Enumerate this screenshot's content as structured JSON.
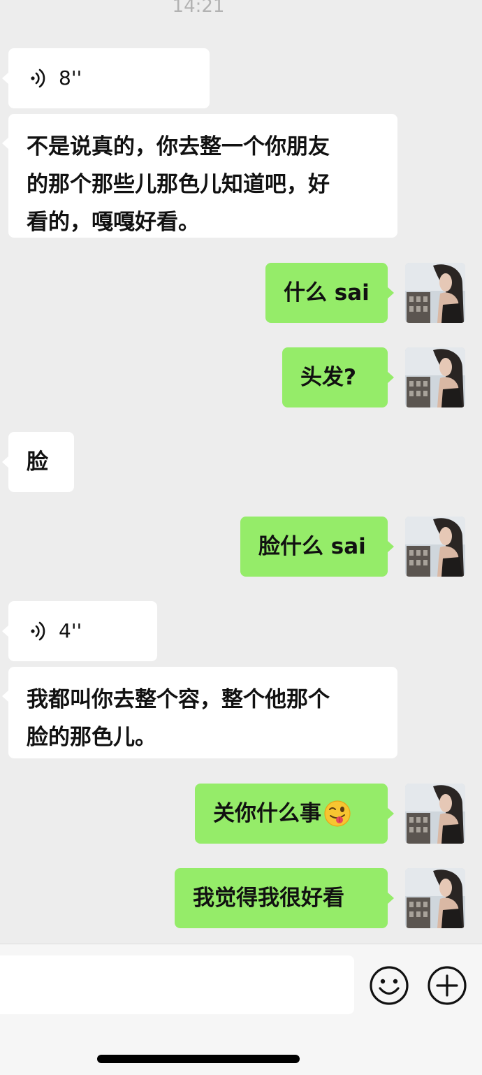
{
  "status": {
    "time": "14:21"
  },
  "messages": [
    {
      "kind": "voice",
      "side": "in",
      "duration": "8''",
      "icon": "voice-wave-icon"
    },
    {
      "kind": "text",
      "side": "in",
      "lines": [
        "不是说真的，你去整一个你朋友",
        "的那个那些儿那色儿知道吧，好",
        "看的，嘎嘎好看。"
      ]
    },
    {
      "kind": "text",
      "side": "out",
      "text": "什么 sai"
    },
    {
      "kind": "text",
      "side": "out",
      "text": "头发?"
    },
    {
      "kind": "text",
      "side": "in",
      "text": "脸"
    },
    {
      "kind": "text",
      "side": "out",
      "text": "脸什么 sai"
    },
    {
      "kind": "voice",
      "side": "in",
      "duration": "4''",
      "icon": "voice-wave-icon"
    },
    {
      "kind": "text",
      "side": "in",
      "lines": [
        "我都叫你去整个容，整个他那个",
        "脸的那色儿。"
      ]
    },
    {
      "kind": "text",
      "side": "out",
      "text": "关你什么事",
      "emoji": "winking-tongue-emoji-icon"
    },
    {
      "kind": "text",
      "side": "out",
      "text": "我觉得我很好看"
    }
  ],
  "input_bar": {
    "placeholder": "",
    "emoji_button_icon": "smiley-face-icon",
    "more_button_icon": "plus-circle-icon"
  },
  "colors": {
    "background": "#ededed",
    "incoming_bubble": "#ffffff",
    "outgoing_bubble": "#95ec69",
    "timestamp": "#b2b2b2"
  }
}
